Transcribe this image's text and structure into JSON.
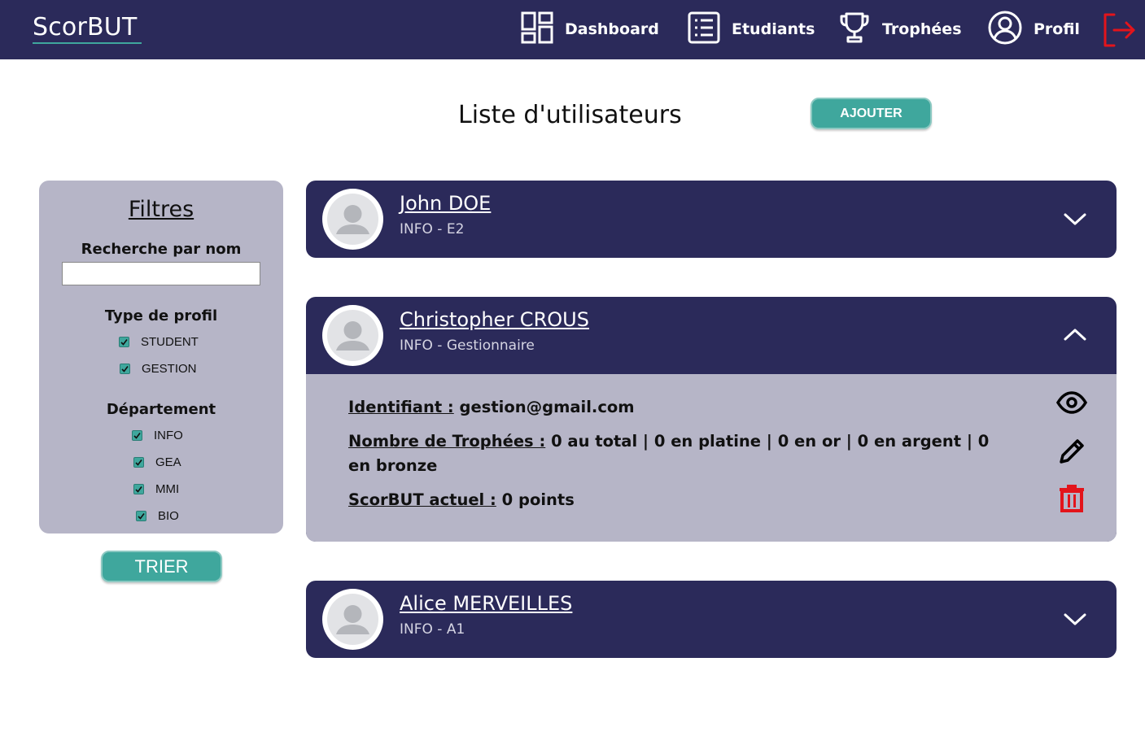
{
  "navbar": {
    "logo": "ScorBUT",
    "items": [
      {
        "label": "Dashboard",
        "icon": "dashboard-icon"
      },
      {
        "label": "Etudiants",
        "icon": "list-icon"
      },
      {
        "label": "Trophées",
        "icon": "trophy-icon"
      },
      {
        "label": "Profil",
        "icon": "user-circle-icon"
      }
    ],
    "logout_icon": "logout-icon"
  },
  "page": {
    "title": "Liste d'utilisateurs",
    "add_label": "AJOUTER"
  },
  "filters": {
    "title": "Filtres",
    "search_label": "Recherche par nom",
    "search_value": "",
    "profile_type_label": "Type de profil",
    "profile_types": [
      {
        "label": "STUDENT",
        "checked": true
      },
      {
        "label": "GESTION",
        "checked": true
      }
    ],
    "department_label": "Département",
    "departments": [
      {
        "label": "INFO",
        "checked": true
      },
      {
        "label": "GEA",
        "checked": true
      },
      {
        "label": "MMI",
        "checked": true
      },
      {
        "label": "BIO",
        "checked": true
      }
    ],
    "sort_label": "TRIER"
  },
  "users": [
    {
      "name": "John DOE",
      "sub": "INFO - E2",
      "expanded": false
    },
    {
      "name": "Christopher CROUS",
      "sub": "INFO - Gestionnaire",
      "expanded": true,
      "details": {
        "id_key": "Identifiant :",
        "id_value": "gestion@gmail.com",
        "trophies_key": "Nombre de Trophées :",
        "trophies_value": "0 au total | 0 en platine | 0 en or | 0 en argent | 0 en bronze",
        "score_key": "ScorBUT actuel :",
        "score_value": "0 points"
      }
    },
    {
      "name": "Alice MERVEILLES",
      "sub": "INFO - A1",
      "expanded": false
    }
  ],
  "colors": {
    "navy": "#2b2a5a",
    "teal": "#3fa79d",
    "panel": "#b6b5c7",
    "danger": "#e3141b"
  }
}
